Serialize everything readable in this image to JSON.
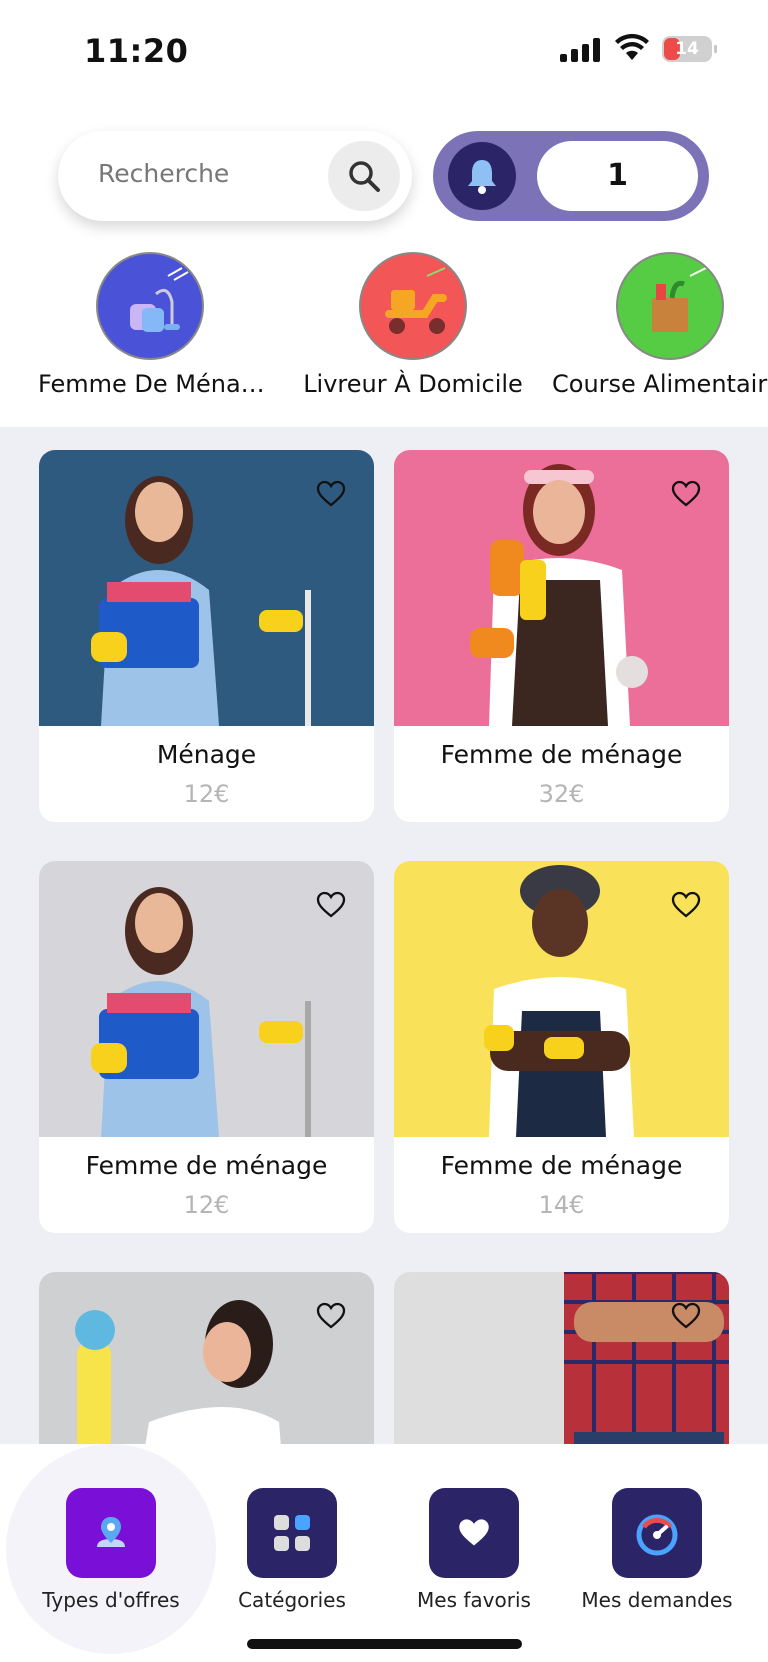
{
  "status_bar": {
    "time": "11:20",
    "battery": "14"
  },
  "search": {
    "placeholder": "Recherche"
  },
  "notifications": {
    "count": "1"
  },
  "categories": [
    {
      "label": "Femme De Ména…",
      "icon": "vacuum-icon",
      "color": "#4a52d8"
    },
    {
      "label": "Livreur À Domicile",
      "icon": "scooter-icon",
      "color": "#f25656"
    },
    {
      "label": "Course Alimentair",
      "icon": "grocery-bag-icon",
      "color": "#56cc44"
    }
  ],
  "offers": [
    {
      "title": "Ménage",
      "price": "12€",
      "bg": "#2f5a80"
    },
    {
      "title": "Femme de ménage",
      "price": "32€",
      "bg": "#ec6f9a"
    },
    {
      "title": "Femme de ménage",
      "price": "12€",
      "bg": "#d6d6da"
    },
    {
      "title": "Femme de ménage",
      "price": "14€",
      "bg": "#fae15a"
    },
    {
      "title": "",
      "price": "",
      "bg": "#cfd0d2"
    },
    {
      "title": "",
      "price": "",
      "bg": "#dedede"
    }
  ],
  "nav": [
    {
      "label": "Types d'offres",
      "icon": "location-pin-icon",
      "active": true
    },
    {
      "label": "Catégories",
      "icon": "grid-icon",
      "active": false
    },
    {
      "label": "Mes favoris",
      "icon": "heart-icon",
      "active": false
    },
    {
      "label": "Mes demandes",
      "icon": "speedometer-icon",
      "active": false
    }
  ],
  "colors": {
    "primary": "#2b2567",
    "active": "#7a0fd8",
    "accent": "#7b72b8"
  }
}
